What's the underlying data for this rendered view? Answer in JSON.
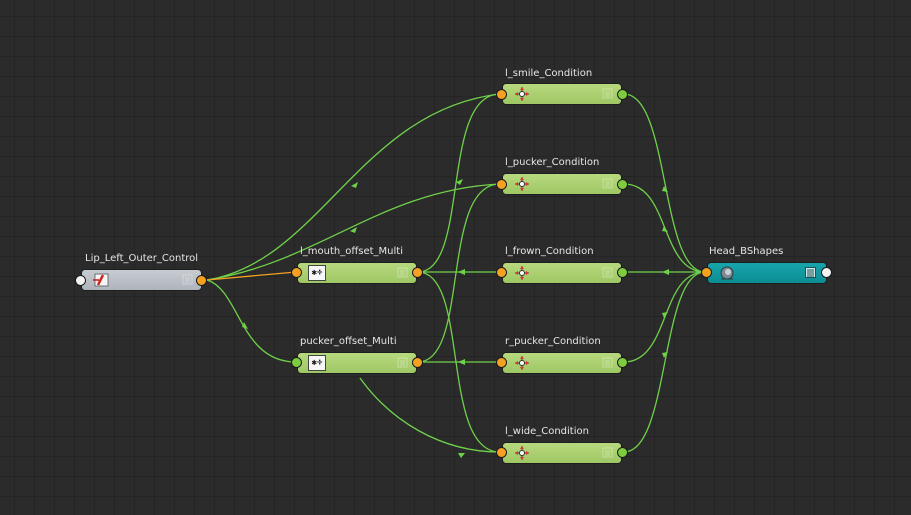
{
  "graph": {
    "nodes": {
      "lip_control": {
        "label": "Lip_Left_Outer_Control",
        "icon": "plugin-icon"
      },
      "mouth_multi": {
        "label": "l_mouth_offset_Multi",
        "icon_text": "✱÷"
      },
      "pucker_multi": {
        "label": "pucker_offset_Multi",
        "icon_text": "✱÷"
      },
      "smile": {
        "label": "l_smile_Condition",
        "icon": "condition-arrows-icon"
      },
      "l_pucker": {
        "label": "l_pucker_Condition",
        "icon": "condition-arrows-icon"
      },
      "frown": {
        "label": "l_frown_Condition",
        "icon": "condition-arrows-icon"
      },
      "r_pucker": {
        "label": "r_pucker_Condition",
        "icon": "condition-arrows-icon"
      },
      "wide": {
        "label": "l_wide_Condition",
        "icon": "condition-arrows-icon"
      },
      "head": {
        "label": "Head_BShapes",
        "icon": "blendshape-icon"
      }
    },
    "colors": {
      "background": "#2b2b2b",
      "wire": "#6fd14a",
      "wire_selected": "#f4a021",
      "node_green": "#a8cf6c",
      "node_grey": "#b8bdc3",
      "node_teal": "#119aa0",
      "port_orange": "#f4a021",
      "port_green": "#7ecb3f"
    }
  }
}
